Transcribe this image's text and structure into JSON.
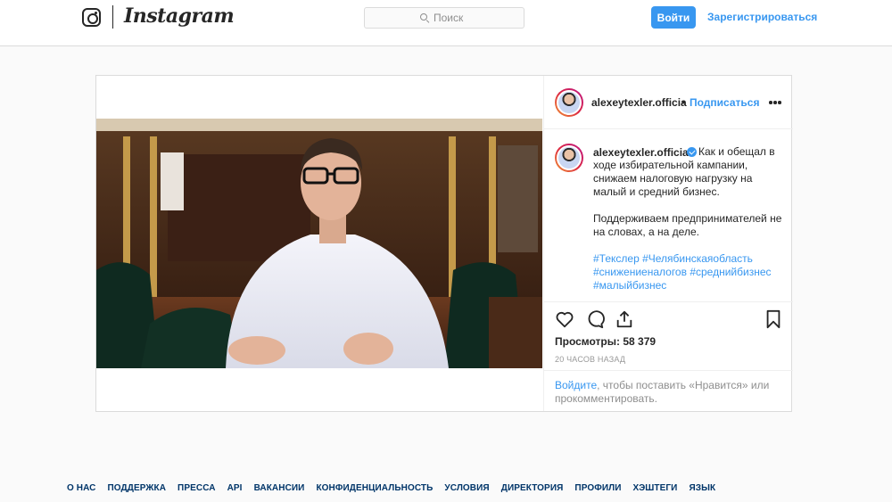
{
  "header": {
    "brand": "Instagram",
    "search_placeholder": "Поиск",
    "login_label": "Войти",
    "signup_label": "Зарегистрироваться"
  },
  "post": {
    "username": "alexeytexler.officia",
    "separator": "•",
    "follow_label": "Подписаться",
    "caption": {
      "username": "alexeytexler.official",
      "verified": true,
      "text_p1": "Как и обещал в ходе избирательной кампании, снижаем налоговую нагрузку на малый и средний бизнес.",
      "text_p2": "Поддерживаем предпринимателей не на словах, а на деле.",
      "hashtags": [
        "#Текслер",
        "#Челябинскаяобласть",
        "#снижениеналогов",
        "#среднийбизнес",
        "#малыйбизнес"
      ]
    },
    "views_label": "Просмотры:",
    "views_count": "58 379",
    "time": "20 ЧАСОВ НАЗАД",
    "login_prompt": {
      "link": "Войдите",
      "text": ", чтобы поставить «Нравится» или прокомментировать."
    }
  },
  "icons": {
    "logo": "instagram-glyph-icon",
    "search": "search-icon",
    "verified": "verified-badge-icon",
    "more": "more-dots-icon",
    "like": "heart-icon",
    "comment": "comment-bubble-icon",
    "share": "share-icon",
    "save": "bookmark-icon"
  },
  "colors": {
    "accent": "#3897f0",
    "footer_link": "#003569",
    "muted": "#8e8e8e"
  },
  "footer": {
    "links": [
      "О НАС",
      "ПОДДЕРЖКА",
      "ПРЕССА",
      "API",
      "ВАКАНСИИ",
      "КОНФИДЕНЦИАЛЬНОСТЬ",
      "УСЛОВИЯ",
      "ДИРЕКТОРИЯ",
      "ПРОФИЛИ",
      "ХЭШТЕГИ",
      "ЯЗЫК"
    ]
  }
}
